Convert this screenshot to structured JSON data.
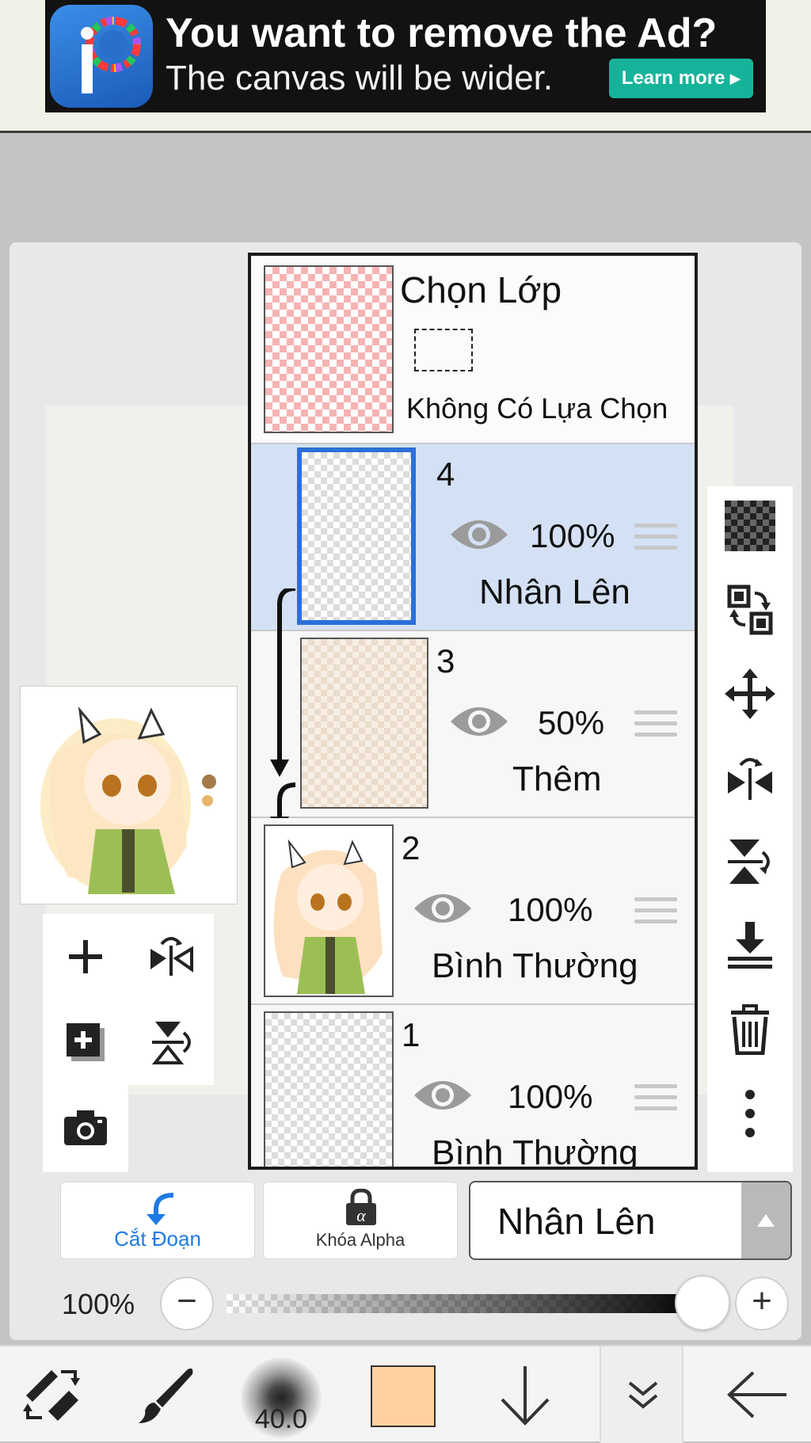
{
  "ad": {
    "title": "You want to remove the Ad?",
    "subtitle": "The canvas will be wider.",
    "button_label": "Learn more",
    "logo_text": "iP",
    "brand_color": "#2f7ad6"
  },
  "selection_layer": {
    "title": "Chọn Lớp",
    "status": "Không Có Lựa Chọn"
  },
  "layers": [
    {
      "number": "4",
      "opacity": "100%",
      "blend_mode": "Nhân Lên",
      "selected": true,
      "clipped": true
    },
    {
      "number": "3",
      "opacity": "50%",
      "blend_mode": "Thêm",
      "selected": false,
      "clipped": true
    },
    {
      "number": "2",
      "opacity": "100%",
      "blend_mode": "Bình Thường",
      "selected": false,
      "clipped": false
    },
    {
      "number": "1",
      "opacity": "100%",
      "blend_mode": "Bình Thường",
      "selected": false,
      "clipped": false
    }
  ],
  "layer_options": {
    "clipping_label": "Cắt Đoạn",
    "alpha_lock_label": "Khóa Alpha",
    "blend_mode": "Nhân Lên"
  },
  "opacity": {
    "label": "100%",
    "value": 1.0
  },
  "toolbar": {
    "brush_size": "40.0",
    "current_color": "#ffd1a0",
    "accent_color": "#1e7be6"
  },
  "icons": {
    "left_tools": [
      "add-layer-icon",
      "flip-horizontal-icon",
      "add-layer-copy-icon",
      "flip-vertical-icon",
      "camera-icon"
    ],
    "right_tools": [
      "transparency-checker-icon",
      "swap-layer-icon",
      "move-icon",
      "flip-layer-horizontal-icon",
      "flip-layer-vertical-icon",
      "merge-down-icon",
      "delete-icon",
      "more-options-icon"
    ],
    "bottom_tools": [
      "transform-tool-icon",
      "brush-icon",
      "brush-size-icon",
      "color-swatch",
      "move-down-icon",
      "collapse-icon",
      "back-arrow-icon"
    ]
  }
}
